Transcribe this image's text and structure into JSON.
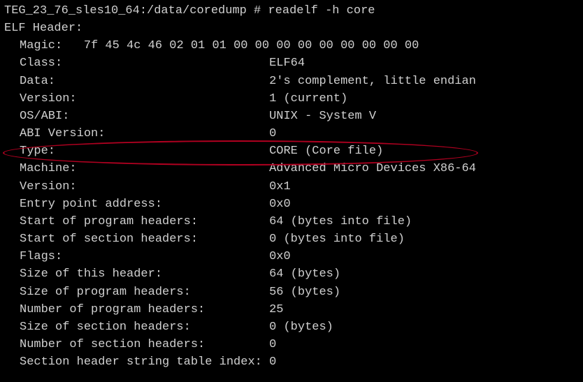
{
  "prompt": {
    "host_path": "TEG_23_76_sles10_64:/data/coredump #",
    "command": "readelf -h core"
  },
  "header": "ELF Header:",
  "magic": {
    "label": "Magic:",
    "bytes": "7f 45 4c 46 02 01 01 00 00 00 00 00 00 00 00 00"
  },
  "fields": [
    {
      "label": "Class:",
      "value": "ELF64"
    },
    {
      "label": "Data:",
      "value": "2's complement, little endian"
    },
    {
      "label": "Version:",
      "value": "1 (current)"
    },
    {
      "label": "OS/ABI:",
      "value": "UNIX - System V"
    },
    {
      "label": "ABI Version:",
      "value": "0"
    },
    {
      "label": "Type:",
      "value": "CORE (Core file)"
    },
    {
      "label": "Machine:",
      "value": "Advanced Micro Devices X86-64"
    },
    {
      "label": "Version:",
      "value": "0x1"
    },
    {
      "label": "Entry point address:",
      "value": "0x0"
    },
    {
      "label": "Start of program headers:",
      "value": "64 (bytes into file)"
    },
    {
      "label": "Start of section headers:",
      "value": "0 (bytes into file)"
    },
    {
      "label": "Flags:",
      "value": "0x0"
    },
    {
      "label": "Size of this header:",
      "value": "64 (bytes)"
    },
    {
      "label": "Size of program headers:",
      "value": "56 (bytes)"
    },
    {
      "label": "Number of program headers:",
      "value": "25"
    },
    {
      "label": "Size of section headers:",
      "value": "0 (bytes)"
    },
    {
      "label": "Number of section headers:",
      "value": "0"
    },
    {
      "label": "Section header string table index:",
      "value": "0"
    }
  ]
}
